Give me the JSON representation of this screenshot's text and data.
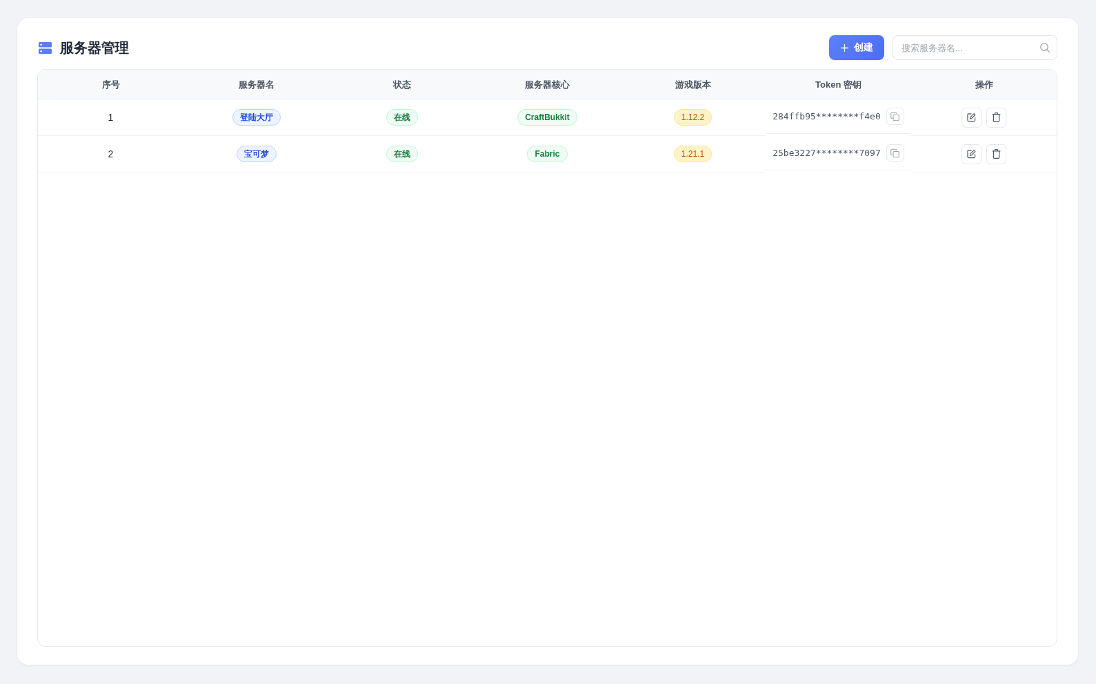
{
  "header": {
    "title": "服务器管理",
    "create_button": {
      "label": "创建"
    },
    "search": {
      "placeholder": "搜索服务器名..."
    }
  },
  "table": {
    "columns": [
      {
        "label": "序号",
        "kind": "index"
      },
      {
        "label": "服务器名",
        "kind": "name"
      },
      {
        "label": "状态",
        "kind": "status"
      },
      {
        "label": "服务器核心",
        "kind": "core"
      },
      {
        "label": "游戏版本",
        "kind": "version"
      },
      {
        "label": "Token 密钥",
        "kind": "token"
      },
      {
        "label": "操作",
        "kind": "actions"
      }
    ],
    "rows": [
      {
        "index": "1",
        "name": "登陆大厅",
        "status": "在线",
        "core": "CraftBukkit",
        "version": "1.12.2",
        "token": "284ffb95********f4e0"
      },
      {
        "index": "2",
        "name": "宝可梦",
        "status": "在线",
        "core": "Fabric",
        "version": "1.21.1",
        "token": "25be3227********7097"
      }
    ]
  }
}
